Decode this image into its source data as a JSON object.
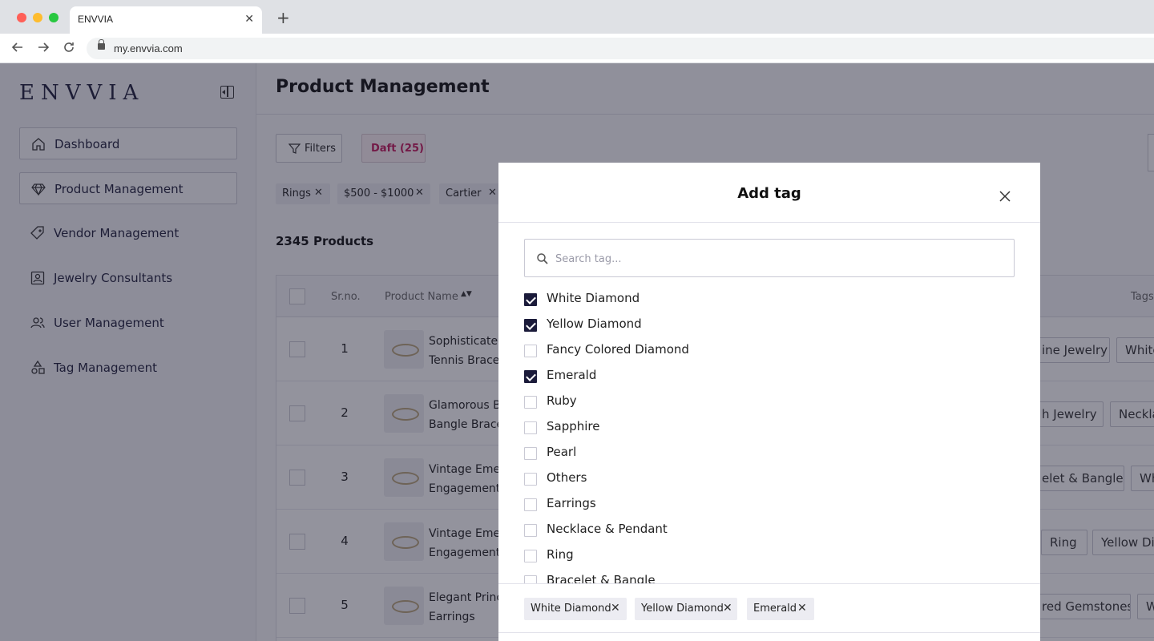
{
  "browser": {
    "tab_title": "ENVVIA",
    "tab_close": "✕",
    "new_tab": "+",
    "url": "my.envvia.com"
  },
  "sidebar": {
    "logo": "ENVVIA",
    "items": [
      {
        "label": "Dashboard",
        "icon": "home-icon"
      },
      {
        "label": "Product Management",
        "icon": "diamond-icon"
      },
      {
        "label": "Vendor Management",
        "icon": "tag-icon"
      },
      {
        "label": "Jewelry Consultants",
        "icon": "id-card-icon"
      },
      {
        "label": "User Management",
        "icon": "users-icon"
      },
      {
        "label": "Tag Management",
        "icon": "shapes-icon"
      }
    ]
  },
  "main": {
    "title": "Product Management",
    "filters_label": "Filters",
    "draft_label": "Daft (25)",
    "chips": [
      "Rings",
      "$500 - $1000",
      "Cartier"
    ],
    "chip_close": "✕",
    "product_count": "2345 Products",
    "table": {
      "headers": {
        "srno": "Sr.no.",
        "name": "Product Name",
        "tags": "Tags",
        "sort": "▲▼"
      },
      "rows": [
        {
          "num": "1",
          "name_line1": "Sophisticated",
          "name_line2": "Tennis Bracel",
          "tag1": "ine Jewelry",
          "tag2": "White"
        },
        {
          "num": "2",
          "name_line1": "Glamorous B",
          "name_line2": "Bangle Brace",
          "tag1": "h Jewelry",
          "tag2": "Necklac"
        },
        {
          "num": "3",
          "name_line1": "Vintage Eme",
          "name_line2": "Engagement",
          "tag1": "elet & Bangle",
          "tag2": "Wh"
        },
        {
          "num": "4",
          "name_line1": "Vintage Eme",
          "name_line2": "Engagement",
          "tag1": "Ring",
          "tag2": "Yellow Dia"
        },
        {
          "num": "5",
          "name_line1": "Elegant Princ",
          "name_line2": "Earrings",
          "tag1": "red Gemstones",
          "tag2": "W"
        }
      ]
    }
  },
  "modal": {
    "title": "Add tag",
    "search_placeholder": "Search tag...",
    "options": [
      {
        "label": "White Diamond",
        "checked": true
      },
      {
        "label": "Yellow Diamond",
        "checked": true
      },
      {
        "label": "Fancy Colored Diamond",
        "checked": false
      },
      {
        "label": "Emerald",
        "checked": true
      },
      {
        "label": "Ruby",
        "checked": false
      },
      {
        "label": "Sapphire",
        "checked": false
      },
      {
        "label": "Pearl",
        "checked": false
      },
      {
        "label": "Others",
        "checked": false
      },
      {
        "label": "Earrings",
        "checked": false
      },
      {
        "label": "Necklace & Pendant",
        "checked": false
      },
      {
        "label": "Ring",
        "checked": false
      },
      {
        "label": "Bracelet & Bangle",
        "checked": false
      }
    ],
    "selected": [
      "White Diamond",
      "Yellow Diamond",
      "Emerald"
    ],
    "remove_glyph": "✕"
  },
  "colors": {
    "accent": "#1b1b3a",
    "draft": "#c2185b",
    "overlay": "#1e1e32"
  }
}
